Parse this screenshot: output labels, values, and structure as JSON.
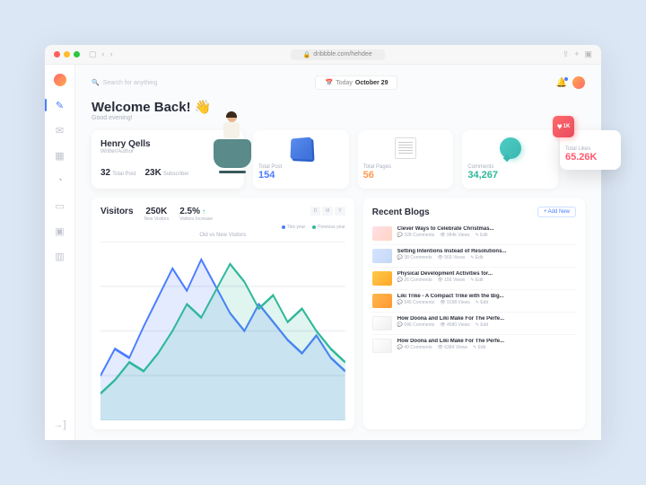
{
  "browser": {
    "url": "dribbble.com/hehdee"
  },
  "topbar": {
    "search_placeholder": "Search for anything",
    "date_prefix": "Today",
    "date": "October 29"
  },
  "welcome": {
    "title": "Welcome Back! 👋",
    "sub": "Good evening!"
  },
  "profile": {
    "name": "Henry Qells",
    "role": "Writter/Author",
    "total_post": "32",
    "total_post_label": "Total Post",
    "subscriber": "23K",
    "subscriber_label": "Subscriber"
  },
  "cards": {
    "post": {
      "label": "Total Post",
      "value": "154"
    },
    "pages": {
      "label": "Total Pages",
      "value": "56"
    },
    "comments": {
      "label": "Comments",
      "value": "34,267"
    },
    "likes": {
      "label": "Total Likes",
      "value": "65.26K",
      "badge": "1K"
    }
  },
  "visitors": {
    "title": "Visitors",
    "new": {
      "value": "250K",
      "label": "New Visitors"
    },
    "inc": {
      "value": "2.5%",
      "label": "Visitors Increase"
    },
    "range": {
      "d": "D",
      "m": "M",
      "y": "Y"
    },
    "legend": {
      "this": "This year",
      "prev": "Previous year"
    },
    "chart_title": "Old vs New Visitors"
  },
  "blogs": {
    "title": "Recent Blogs",
    "add": "+ Add New",
    "edit": "Edit",
    "items": [
      {
        "t": "Clever Ways to Celebrate Christmas...",
        "c": "328 Comments",
        "v": "984k Views"
      },
      {
        "t": "Setting Intentions Instead of Resolutions...",
        "c": "38 Comments",
        "v": "569 Views"
      },
      {
        "t": "Physical Development Activities for...",
        "c": "26 Comments",
        "v": "156 Views"
      },
      {
        "t": "Liki Trike - A Compact Trike with the Big...",
        "c": "545 Comments",
        "v": "9198 Views"
      },
      {
        "t": "How Doona and Liki Make For The Perfe...",
        "c": "546 Comments",
        "v": "4580 Views"
      },
      {
        "t": "How Doona and Liki Make For The Perfe...",
        "c": "49 Comments",
        "v": "6384 Views"
      }
    ]
  },
  "chart_data": {
    "type": "line",
    "title": "Old vs New Visitors",
    "x": [
      0,
      1,
      2,
      3,
      4,
      5,
      6,
      7,
      8,
      9,
      10,
      11,
      12,
      13,
      14,
      15,
      16,
      17
    ],
    "series": [
      {
        "name": "This year",
        "color": "#4a7cff",
        "values": [
          20,
          32,
          28,
          42,
          55,
          68,
          58,
          72,
          60,
          48,
          40,
          52,
          44,
          36,
          30,
          38,
          28,
          22
        ]
      },
      {
        "name": "Previous year",
        "color": "#2fb89a",
        "values": [
          12,
          18,
          26,
          22,
          30,
          40,
          52,
          46,
          58,
          70,
          62,
          50,
          56,
          44,
          50,
          40,
          32,
          26
        ]
      }
    ],
    "ylim": [
      0,
      80
    ]
  }
}
